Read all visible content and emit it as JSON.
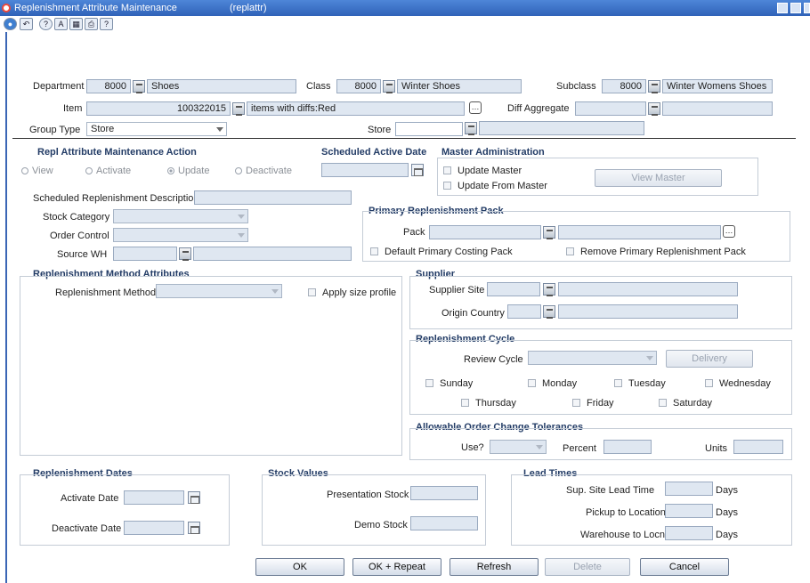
{
  "window": {
    "title": "Replenishment Attribute Maintenance",
    "form_id": "(replattr)"
  },
  "toolbar": {
    "icons": [
      "globe-icon",
      "back-arrow-icon",
      "help-icon",
      "spellcheck-icon",
      "calculator-icon",
      "print-icon",
      "question-icon"
    ]
  },
  "header": {
    "department": {
      "label": "Department",
      "code": "8000",
      "name": "Shoes"
    },
    "class": {
      "label": "Class",
      "code": "8000",
      "name": "Winter Shoes"
    },
    "subclass": {
      "label": "Subclass",
      "code": "8000",
      "name": "Winter Womens Shoes"
    },
    "item": {
      "label": "Item",
      "code": "100322015",
      "name": "items with diffs:Red"
    },
    "diff_aggregate": {
      "label": "Diff Aggregate",
      "code": "",
      "name": ""
    },
    "group_type": {
      "label": "Group Type",
      "value": "Store"
    },
    "store": {
      "label": "Store",
      "code": "",
      "name": ""
    }
  },
  "action": {
    "title": "Repl Attribute Maintenance Action",
    "options": [
      "View",
      "Activate",
      "Update",
      "Deactivate"
    ],
    "selected": "Update"
  },
  "scheduled_active_date": {
    "title": "Scheduled Active Date",
    "value": ""
  },
  "master_admin": {
    "title": "Master Administration",
    "update_master": "Update Master",
    "update_from_master": "Update From Master",
    "view_master": "View Master"
  },
  "misc": {
    "sched_desc_label": "Scheduled Replenishment Description",
    "stock_category_label": "Stock Category",
    "order_control_label": "Order Control",
    "source_wh_label": "Source WH"
  },
  "primary_pack": {
    "title": "Primary Replenishment Pack",
    "pack_label": "Pack",
    "default_costing": "Default Primary Costing Pack",
    "remove_pack": "Remove Primary Replenishment Pack"
  },
  "repl_method": {
    "title": "Replenishment Method Attributes",
    "method_label": "Replenishment Method",
    "apply_size_profile": "Apply size profile"
  },
  "supplier": {
    "title": "Supplier",
    "site_label": "Supplier Site",
    "origin_label": "Origin Country"
  },
  "cycle": {
    "title": "Replenishment Cycle",
    "review_label": "Review Cycle",
    "delivery_button": "Delivery",
    "days": [
      "Sunday",
      "Monday",
      "Tuesday",
      "Wednesday",
      "Thursday",
      "Friday",
      "Saturday"
    ]
  },
  "tolerances": {
    "title": "Allowable Order Change Tolerances",
    "use_label": "Use?",
    "percent_label": "Percent",
    "units_label": "Units"
  },
  "repl_dates": {
    "title": "Replenishment Dates",
    "activate_label": "Activate Date",
    "deactivate_label": "Deactivate Date"
  },
  "stock_values": {
    "title": "Stock Values",
    "presentation_label": "Presentation Stock",
    "demo_label": "Demo Stock"
  },
  "lead_times": {
    "title": "Lead Times",
    "sup_site_label": "Sup. Site Lead Time",
    "pickup_label": "Pickup to Location",
    "warehouse_label": "Warehouse to Locn",
    "unit": "Days"
  },
  "buttons": {
    "ok": "OK",
    "ok_repeat": "OK + Repeat",
    "refresh": "Refresh",
    "delete": "Delete",
    "cancel": "Cancel"
  }
}
